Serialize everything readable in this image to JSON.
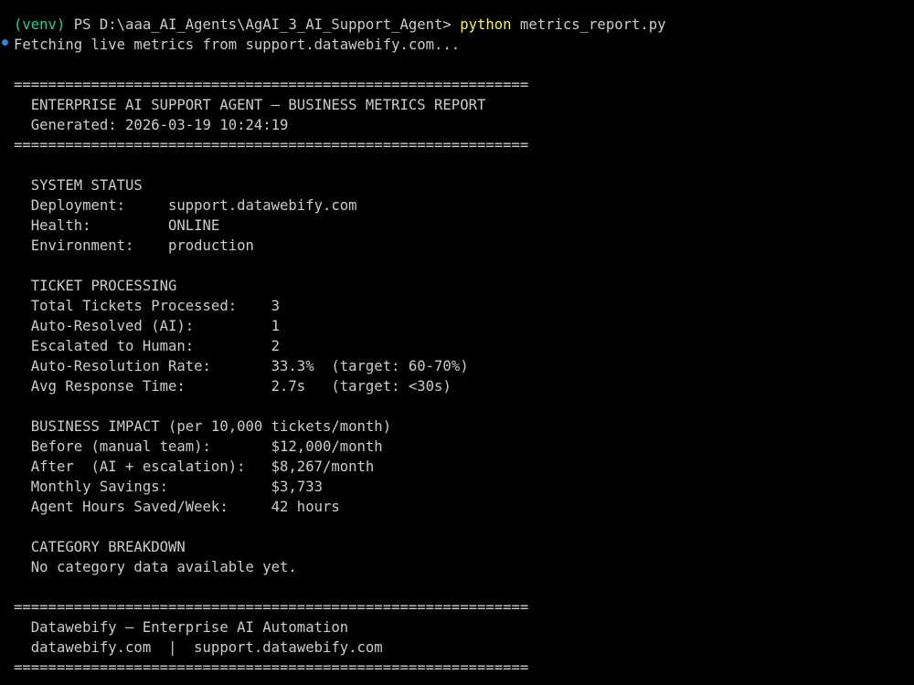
{
  "prompt": {
    "venv": "(venv)",
    "path": " PS D:\\aaa_AI_Agents\\AgAI_3_AI_Support_Agent> ",
    "command": "python",
    "args": " metrics_report.py"
  },
  "fetching": "Fetching live metrics from support.datawebify.com...",
  "separator": "============================================================",
  "header": {
    "title": "  ENTERPRISE AI SUPPORT AGENT — BUSINESS METRICS REPORT",
    "generated": "  Generated: 2026-03-19 10:24:19"
  },
  "system_status": {
    "heading": "  SYSTEM STATUS",
    "deployment": "  Deployment:     support.datawebify.com",
    "health": "  Health:         ONLINE",
    "environment": "  Environment:    production"
  },
  "ticket_processing": {
    "heading": "  TICKET PROCESSING",
    "total": "  Total Tickets Processed:    3",
    "auto_resolved": "  Auto-Resolved (AI):         1",
    "escalated": "  Escalated to Human:         2",
    "rate": "  Auto-Resolution Rate:       33.3%  (target: 60-70%)",
    "response_time": "  Avg Response Time:          2.7s   (target: <30s)"
  },
  "business_impact": {
    "heading": "  BUSINESS IMPACT (per 10,000 tickets/month)",
    "before": "  Before (manual team):       $12,000/month",
    "after": "  After  (AI + escalation):   $8,267/month",
    "savings": "  Monthly Savings:            $3,733",
    "hours": "  Agent Hours Saved/Week:     42 hours"
  },
  "category_breakdown": {
    "heading": "  CATEGORY BREAKDOWN",
    "empty": "  No category data available yet."
  },
  "footer": {
    "brand": "  Datawebify — Enterprise AI Automation",
    "links": "  datawebify.com  |  support.datawebify.com"
  },
  "colors": {
    "background": "#000000",
    "text": "#cccccc",
    "venv": "#23d18b",
    "command": "#f5f543",
    "marker": "#2b88d8"
  }
}
